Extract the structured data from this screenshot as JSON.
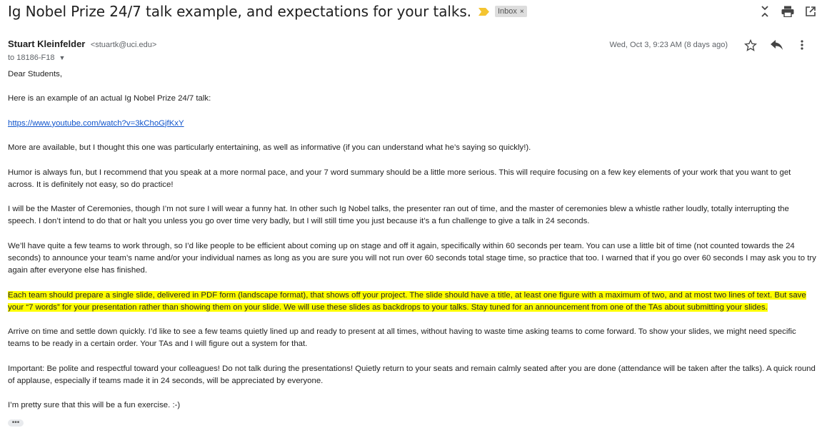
{
  "email": {
    "subject": "Ig Nobel Prize 24/7 talk example, and expectations for your talks.",
    "label": "Inbox",
    "label_close": "×",
    "sender_name": "Stuart Kleinfelder",
    "sender_email": "<stuartk@uci.edu>",
    "to": "to 18186-F18",
    "date": "Wed, Oct 3, 9:23 AM (8 days ago)"
  },
  "body": {
    "greeting": "Dear Students,",
    "p1": "Here is an example of an actual Ig Nobel Prize 24/7 talk:",
    "link": "https://www.youtube.com/watch?v=3kChoGjfKxY",
    "p2": "More are available, but I thought this one was particularly entertaining, as well as informative (if you can understand what he’s saying so quickly!).",
    "p3": "Humor is always fun, but I recommend that you speak at a more normal pace, and your 7 word summary should be a little more serious. This will require focusing on a few key elements of your work that you want to get across. It is definitely not easy, so do practice!",
    "p4": "I will be the Master of Ceremonies, though I’m not sure I will wear a funny hat. In other such Ig Nobel talks, the presenter ran out of time, and the master of ceremonies blew a whistle rather loudly, totally interrupting the speech. I don’t intend to do that or halt you unless you go over time very badly, but I will still time you just because it’s a fun challenge to give a talk in 24 seconds.",
    "p5": "We’ll have quite a few teams to work through, so I’d like people to be efficient about coming up on stage and off it again, specifically within 60 seconds per team. You can use a little bit of time (not counted towards the 24 seconds) to announce your team’s name and/or your individual names as long as you are sure you will not run over 60 seconds total stage time, so practice that too. I warned that if you go over 60 seconds I may ask you to try again after everyone else has finished.",
    "p6": "Each team should prepare a single slide, delivered in PDF form (landscape format), that shows off your project. The slide should have a title, at least one figure with a maximum of two, and at most two lines of text. But save your “7 words” for your presentation rather than showing them on your slide. We will use these slides as backdrops to your talks. Stay tuned for an announcement from one of the TAs about submitting your slides.",
    "p7": "Arrive on time and settle down quickly. I’d like to see a few teams quietly lined up and ready to present at all times, without having to waste time asking teams to come forward. To show your slides, we might need specific teams to be ready in a certain order. Your TAs and I will figure out a system for that.",
    "p8": "Important: Be polite and respectful toward your colleagues! Do not talk during the presentations! Quietly return to your seats and remain calmly seated after you are done (attendance will be taken after the talks). A quick round of applause, especially if teams made it in 24 seconds, will be appreciated by everyone.",
    "p9": "I’m pretty sure that this will be a fun exercise. :-)",
    "more": "•••"
  },
  "colors": {
    "highlight": "#ffff00",
    "link": "#1155cc",
    "importance": "#f4c430"
  },
  "icons": [
    "importance-marker-icon",
    "collapse-icon",
    "print-icon",
    "open-new-window-icon",
    "star-icon",
    "reply-icon",
    "more-vert-icon",
    "chevron-down-icon"
  ]
}
